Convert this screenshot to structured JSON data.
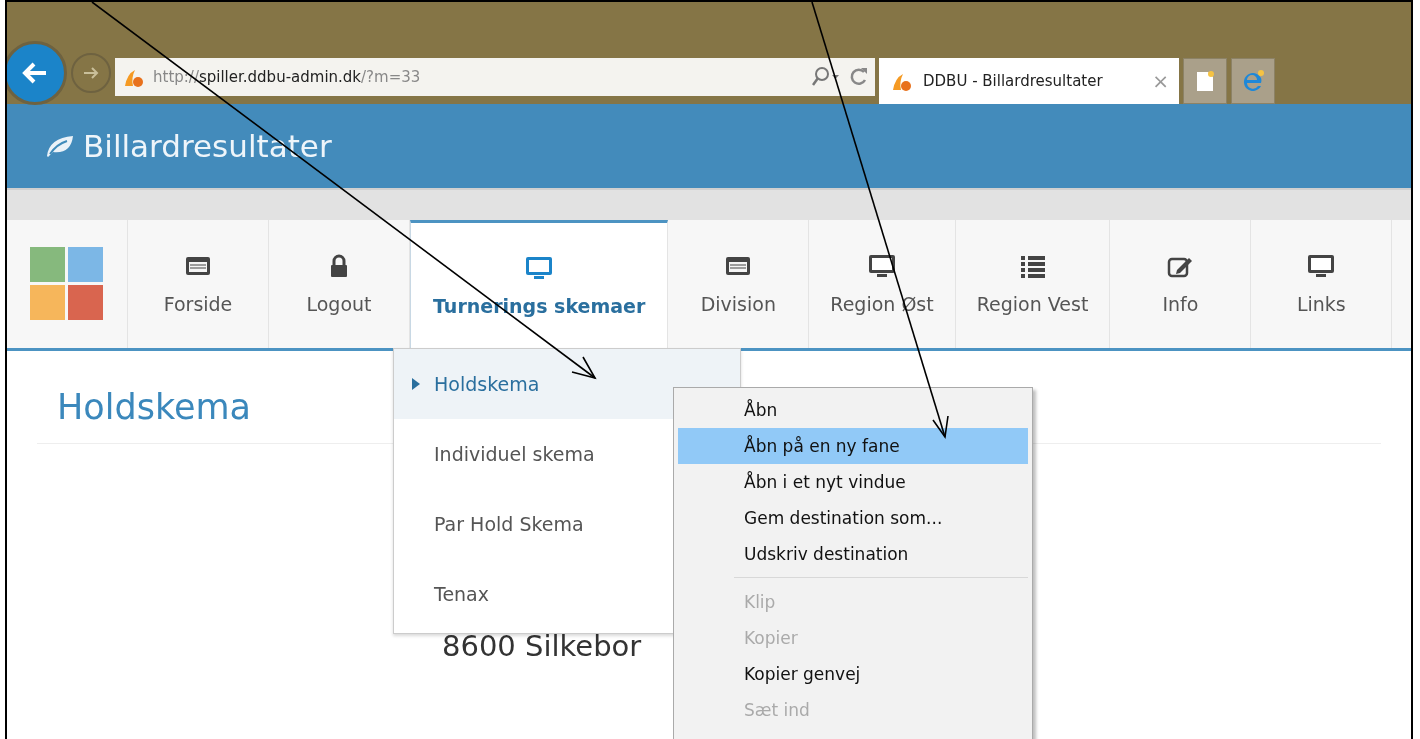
{
  "browser": {
    "address": {
      "prefix": "http://",
      "host": "spiller.ddbu-admin.dk",
      "path": "/?m=33"
    },
    "tab": {
      "title": "DDBU - Billardresultater",
      "close": "×"
    }
  },
  "site": {
    "title": "Billardresultater"
  },
  "nav": [
    {
      "label": "Forside",
      "kind": "window",
      "selected": false
    },
    {
      "label": "Logout",
      "kind": "lock",
      "selected": false
    },
    {
      "label": "Turnerings skemaer",
      "kind": "monitor",
      "selected": true
    },
    {
      "label": "Division",
      "kind": "window",
      "selected": false
    },
    {
      "label": "Region Øst",
      "kind": "monitor",
      "selected": false
    },
    {
      "label": "Region Vest",
      "kind": "list",
      "selected": false
    },
    {
      "label": "Info",
      "kind": "edit",
      "selected": false
    },
    {
      "label": "Links",
      "kind": "monitor",
      "selected": false
    }
  ],
  "dropdown": [
    {
      "label": "Holdskema",
      "selected": true
    },
    {
      "label": "Individuel skema",
      "selected": false
    },
    {
      "label": "Par Hold Skema",
      "selected": false
    },
    {
      "label": "Tenax",
      "selected": false
    }
  ],
  "page": {
    "heading": "Holdskema",
    "address_line": "8600 Silkebor"
  },
  "context_menu": [
    {
      "kind": "item",
      "label": "Åbn",
      "selected": false,
      "disabled": false
    },
    {
      "kind": "item",
      "label": "Åbn på en ny fane",
      "selected": true,
      "disabled": false
    },
    {
      "kind": "item",
      "label": "Åbn i et nyt vindue",
      "selected": false,
      "disabled": false
    },
    {
      "kind": "item",
      "label": "Gem destination som...",
      "selected": false,
      "disabled": false
    },
    {
      "kind": "item",
      "label": "Udskriv destination",
      "selected": false,
      "disabled": false
    },
    {
      "kind": "separator"
    },
    {
      "kind": "item",
      "label": "Klip",
      "selected": false,
      "disabled": true
    },
    {
      "kind": "item",
      "label": "Kopier",
      "selected": false,
      "disabled": true
    },
    {
      "kind": "item",
      "label": "Kopier genvej",
      "selected": false,
      "disabled": false
    },
    {
      "kind": "item",
      "label": "Sæt ind",
      "selected": false,
      "disabled": true
    }
  ]
}
